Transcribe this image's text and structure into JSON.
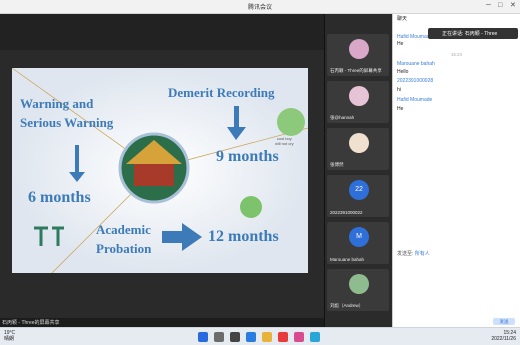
{
  "window": {
    "title": "腾讯会议"
  },
  "slide": {
    "warning": "Warning and",
    "serious": "Serious Warning",
    "months6": "6 months",
    "demerit": "Demerit Recording",
    "months9": "9 months",
    "academic": "Academic",
    "probation": "Probation",
    "months12": "12 months",
    "sticker_caption1": "cool boy",
    "sticker_caption2": "will not cry",
    "tt": "TT"
  },
  "share": {
    "label": "石丙颖 - Three的屏幕共享"
  },
  "participants": [
    {
      "name": "石丙颖 - Three的屏幕共享",
      "color": "#d9a7c7"
    },
    {
      "name": "张@hannah",
      "color": "#e6c3d6"
    },
    {
      "name": "张博然",
      "color": "#f0e0d0"
    },
    {
      "name": "2022391000022",
      "initial": "22",
      "color": "#2f6fd9"
    },
    {
      "name": "Marouane bahah",
      "initial": "M",
      "color": "#2f6fd9"
    },
    {
      "name": "刘彪（Andrew）",
      "color": "#8fbc8f"
    }
  ],
  "chat": {
    "header": "聊天",
    "notification": "正在讲话: 石丙颖 - Three",
    "time": "15:24",
    "messages": [
      {
        "sender": "Hafid Moumade",
        "text": "He"
      },
      {
        "sender": "Marouane bahah",
        "text": "Hello"
      },
      {
        "sender": "2022391000028",
        "text": "hi"
      },
      {
        "sender": "Hafid Moumade",
        "text": "He"
      }
    ],
    "send_to_label": "发送至:",
    "send_to_value": "所有人",
    "send_button": "发送"
  },
  "taskbar": {
    "temp": "19°C",
    "weather": "晴朗",
    "time": "15:24",
    "date": "2022/11/26",
    "lang": "中"
  }
}
